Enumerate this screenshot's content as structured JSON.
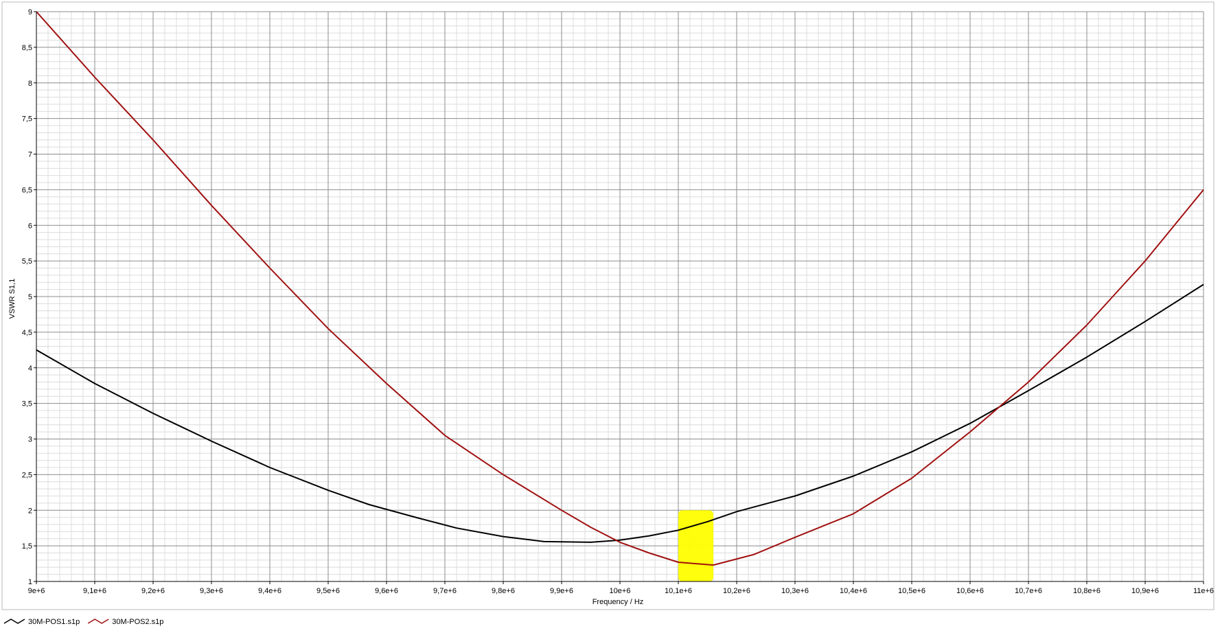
{
  "chart_data": {
    "type": "line",
    "xlabel": "Frequency / Hz",
    "ylabel": "VSWR S1,1",
    "xlim": [
      9000000,
      11000000
    ],
    "ylim": [
      1,
      9
    ],
    "grid": true,
    "x_ticks": [
      "9e+6",
      "9,1e+6",
      "9,2e+6",
      "9,3e+6",
      "9,4e+6",
      "9,5e+6",
      "9,6e+6",
      "9,7e+6",
      "9,8e+6",
      "9,9e+6",
      "10e+6",
      "10,1e+6",
      "10,2e+6",
      "10,3e+6",
      "10,4e+6",
      "10,5e+6",
      "10,6e+6",
      "10,7e+6",
      "10,8e+6",
      "10,9e+6",
      "11e+6"
    ],
    "y_ticks": [
      "1",
      "1,5",
      "2",
      "2,5",
      "3",
      "3,5",
      "4",
      "4,5",
      "5",
      "5,5",
      "6",
      "6,5",
      "7",
      "7,5",
      "8",
      "8,5",
      "9"
    ],
    "highlight": {
      "x_range": [
        10100000,
        10160000
      ],
      "y_range": [
        1.0,
        2.0
      ],
      "color": "#ffff00"
    },
    "legend_position": "bottom-left",
    "series": [
      {
        "name": "30M-POS1.s1p",
        "color": "#000000",
        "x": [
          9000000,
          9100000,
          9200000,
          9300000,
          9400000,
          9500000,
          9570000,
          9650000,
          9720000,
          9800000,
          9870000,
          9950000,
          10000000,
          10050000,
          10100000,
          10150000,
          10200000,
          10300000,
          10400000,
          10500000,
          10600000,
          10700000,
          10800000,
          10900000,
          11000000
        ],
        "y": [
          4.25,
          3.78,
          3.36,
          2.97,
          2.6,
          2.28,
          2.08,
          1.9,
          1.75,
          1.63,
          1.56,
          1.55,
          1.58,
          1.64,
          1.72,
          1.84,
          1.98,
          2.2,
          2.48,
          2.82,
          3.22,
          3.68,
          4.15,
          4.65,
          5.17
        ]
      },
      {
        "name": "30M-POS2.s1p",
        "color": "#a01010",
        "x": [
          9000000,
          9100000,
          9200000,
          9300000,
          9400000,
          9500000,
          9600000,
          9700000,
          9800000,
          9900000,
          9950000,
          10000000,
          10050000,
          10100000,
          10160000,
          10230000,
          10300000,
          10400000,
          10500000,
          10600000,
          10700000,
          10800000,
          10900000,
          11000000
        ],
        "y": [
          9.0,
          8.08,
          7.2,
          6.28,
          5.4,
          4.55,
          3.78,
          3.05,
          2.5,
          2.0,
          1.76,
          1.55,
          1.4,
          1.27,
          1.23,
          1.38,
          1.62,
          1.95,
          2.45,
          3.1,
          3.8,
          4.6,
          5.5,
          6.5
        ]
      }
    ]
  }
}
